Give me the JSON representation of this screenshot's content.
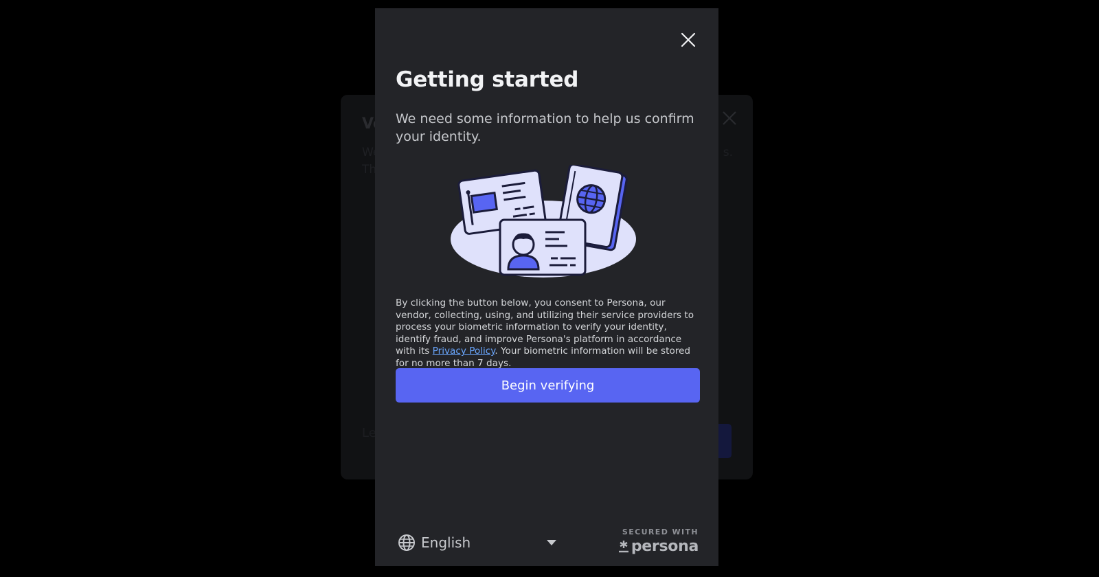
{
  "underlying_modal": {
    "title_fragment": "Ve",
    "text_line1_fragment": "We",
    "text_line1_end": "s.",
    "text_line2_fragment": "Th",
    "left_link_fragment": "Le"
  },
  "modal": {
    "title": "Getting started",
    "subtitle": "We need some information to help us confirm your identity.",
    "consent": {
      "before_link": "By clicking the button below, you consent to Persona, our vendor, collecting, using, and utilizing their service providers to process your biometric information to verify your identity, identify fraud, and improve Persona's platform in accordance with its ",
      "link": "Privacy Policy",
      "after_link": ". Your biometric information will be stored for no more than 7 days."
    },
    "primary_button": "Begin verifying",
    "language": {
      "selected": "English",
      "icon": "globe-icon"
    },
    "footer": {
      "secured_label": "SECURED WITH",
      "brand": "persona"
    }
  },
  "colors": {
    "backdrop": "#000000",
    "modal_bg": "#232428",
    "primary": "#5865f2",
    "link": "#6aa7ff",
    "illustration_accent": "#5865f2",
    "illustration_light": "#dfe1fb"
  }
}
